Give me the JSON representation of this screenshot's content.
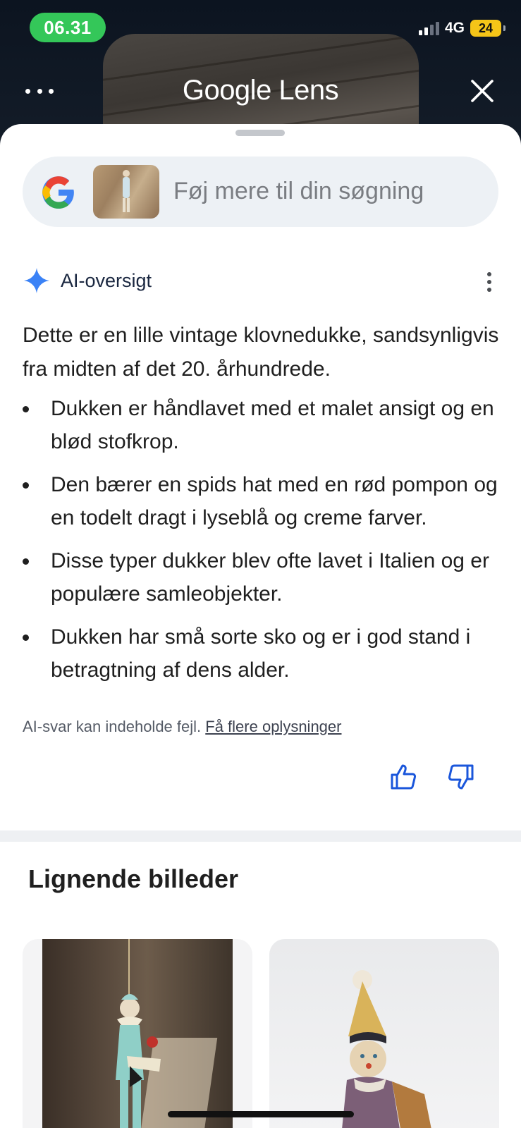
{
  "status_bar": {
    "time": "06.31",
    "network": "4G",
    "battery": "24"
  },
  "header": {
    "title": "Google Lens",
    "more_icon": "more-horizontal-icon",
    "close_icon": "close-icon"
  },
  "search": {
    "placeholder": "Føj mere til din søgning",
    "logo_icon": "google-g-icon"
  },
  "ai_overview": {
    "title": "AI-oversigt",
    "intro": "Dette er en lille vintage klovnedukke, sandsynligvis fra midten af det 20. århundrede.",
    "bullets": [
      "Dukken er håndlavet med et malet ansigt og en blød stofkrop.",
      "Den bærer en spids hat med en rød pompon og en todelt dragt i lyseblå og creme farver.",
      "Disse typer dukker blev ofte lavet i Italien og er populære samleobjekter.",
      "Dukken har små sorte sko og er i god stand i betragtning af dens alder."
    ],
    "disclaimer": "AI-svar kan indeholde fejl.",
    "learn_more": "Få flere oplysninger"
  },
  "similar": {
    "title": "Lignende billeder"
  },
  "colors": {
    "time_pill": "#34c759",
    "battery": "#f5c518",
    "accent_blue": "#1a56db"
  }
}
